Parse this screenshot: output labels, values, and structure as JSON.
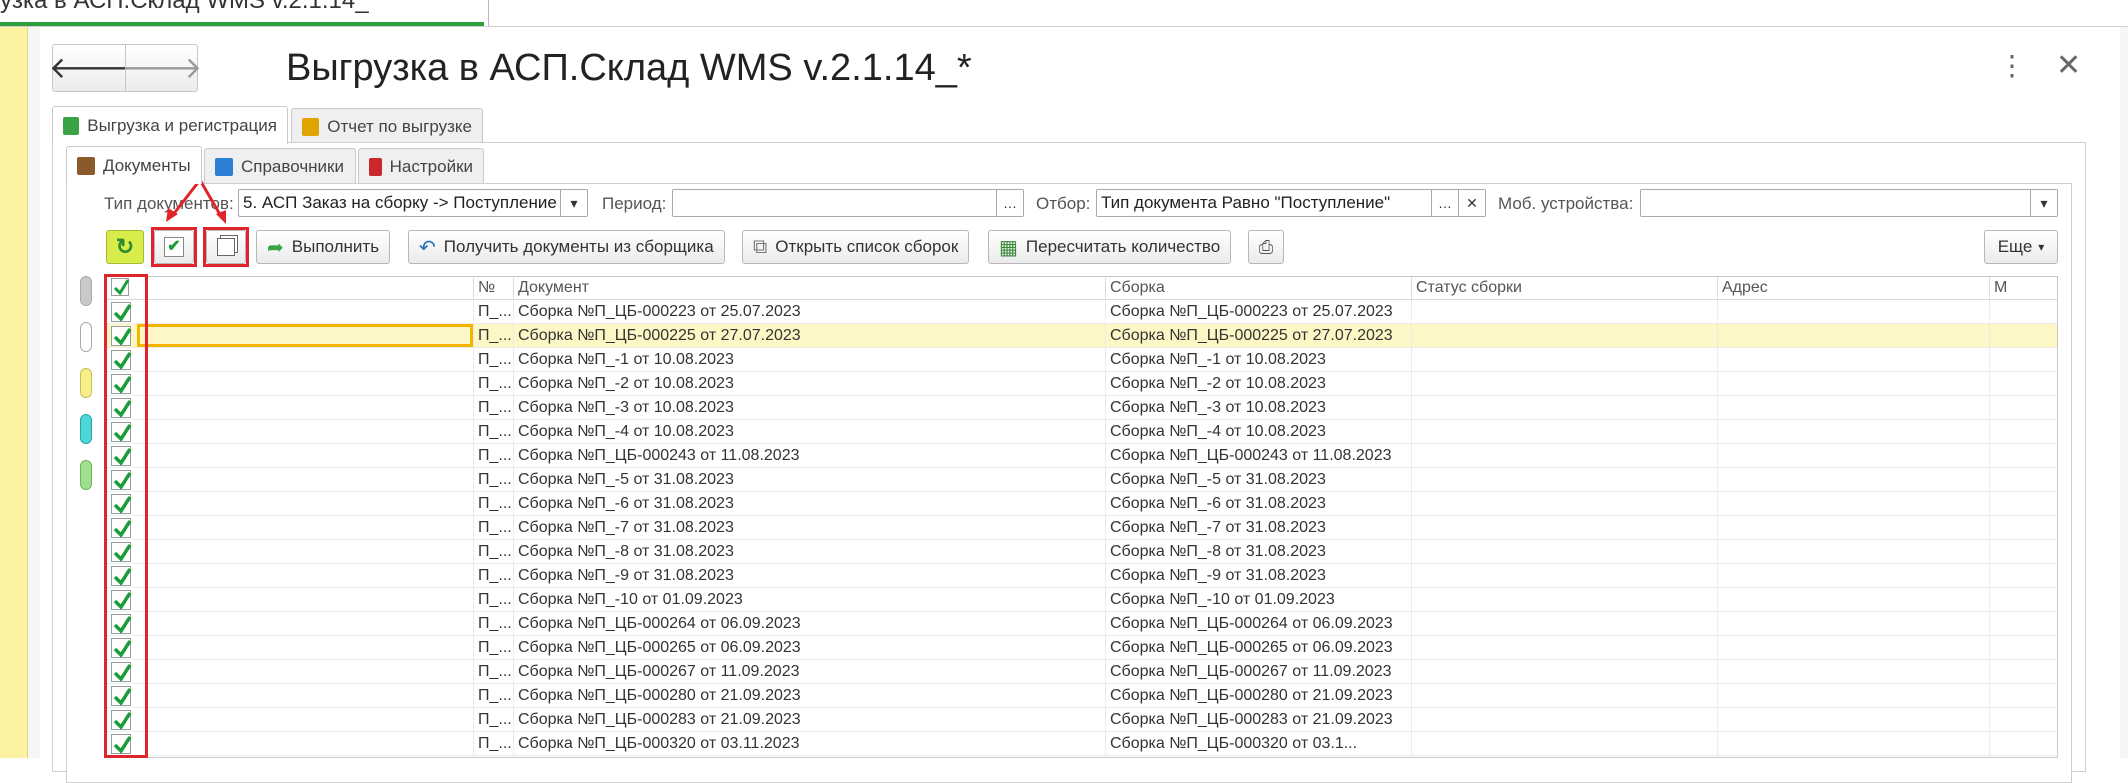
{
  "window_tab": {
    "title": "узка в АСП.Склад WMS v.2.1.14_"
  },
  "header": {
    "title": "Выгрузка в АСП.Склад WMS v.2.1.14_*",
    "back": "🡐",
    "forward": "🡒",
    "menu": "⋮",
    "close": "✕"
  },
  "tabs": [
    {
      "label": "Выгрузка и регистрация",
      "icon": "upload-register-icon",
      "color": "#3aa346"
    },
    {
      "label": "Отчет по выгрузке",
      "icon": "report-icon",
      "color": "#e0a300"
    }
  ],
  "subtabs": [
    {
      "label": "Документы",
      "icon": "briefcase-icon",
      "color": "#8a5a2b"
    },
    {
      "label": "Справочники",
      "icon": "catalog-icon",
      "color": "#2d7fd3"
    },
    {
      "label": "Настройки",
      "icon": "settings-icon",
      "color": "#c9282d"
    }
  ],
  "filters": {
    "doc_type_label": "Тип документов:",
    "doc_type_value": "5. АСП Заказ на сборку -> Поступление",
    "period_label": "Период:",
    "period_value": "",
    "filter_label": "Отбор:",
    "filter_value": "Тип документа Равно \"Поступление\"",
    "mobile_label": "Моб. устройства:",
    "mobile_value": ""
  },
  "toolbar": {
    "execute": "Выполнить",
    "get_docs": "Получить документы из сборщика",
    "open_list": "Открыть список сборок",
    "recount": "Пересчитать количество",
    "more": "Еще"
  },
  "table": {
    "columns": [
      "№",
      "Документ",
      "Сборка",
      "Статус сборки",
      "Адрес",
      "М"
    ],
    "rows": [
      {
        "num": "П_...",
        "doc": "Сборка №П_ЦБ-000223 от 25.07.2023",
        "assembly": "Сборка №П_ЦБ-000223 от 25.07.2023"
      },
      {
        "num": "П_...",
        "doc": "Сборка №П_ЦБ-000225 от 27.07.2023",
        "assembly": "Сборка №П_ЦБ-000225 от 27.07.2023"
      },
      {
        "num": "П_...",
        "doc": "Сборка №П_-1 от 10.08.2023",
        "assembly": "Сборка №П_-1 от 10.08.2023"
      },
      {
        "num": "П_...",
        "doc": "Сборка №П_-2 от 10.08.2023",
        "assembly": "Сборка №П_-2 от 10.08.2023"
      },
      {
        "num": "П_...",
        "doc": "Сборка №П_-3 от 10.08.2023",
        "assembly": "Сборка №П_-3 от 10.08.2023"
      },
      {
        "num": "П_...",
        "doc": "Сборка №П_-4 от 10.08.2023",
        "assembly": "Сборка №П_-4 от 10.08.2023"
      },
      {
        "num": "П_...",
        "doc": "Сборка №П_ЦБ-000243 от 11.08.2023",
        "assembly": "Сборка №П_ЦБ-000243 от 11.08.2023"
      },
      {
        "num": "П_...",
        "doc": "Сборка №П_-5 от 31.08.2023",
        "assembly": "Сборка №П_-5 от 31.08.2023"
      },
      {
        "num": "П_...",
        "doc": "Сборка №П_-6 от 31.08.2023",
        "assembly": "Сборка №П_-6 от 31.08.2023"
      },
      {
        "num": "П_...",
        "doc": "Сборка №П_-7 от 31.08.2023",
        "assembly": "Сборка №П_-7 от 31.08.2023"
      },
      {
        "num": "П_...",
        "doc": "Сборка №П_-8 от 31.08.2023",
        "assembly": "Сборка №П_-8 от 31.08.2023"
      },
      {
        "num": "П_...",
        "doc": "Сборка №П_-9 от 31.08.2023",
        "assembly": "Сборка №П_-9 от 31.08.2023"
      },
      {
        "num": "П_...",
        "doc": "Сборка №П_-10 от 01.09.2023",
        "assembly": "Сборка №П_-10 от 01.09.2023"
      },
      {
        "num": "П_...",
        "doc": "Сборка №П_ЦБ-000264 от 06.09.2023",
        "assembly": "Сборка №П_ЦБ-000264 от 06.09.2023"
      },
      {
        "num": "П_...",
        "doc": "Сборка №П_ЦБ-000265 от 06.09.2023",
        "assembly": "Сборка №П_ЦБ-000265 от 06.09.2023"
      },
      {
        "num": "П_...",
        "doc": "Сборка №П_ЦБ-000267 от 11.09.2023",
        "assembly": "Сборка №П_ЦБ-000267 от 11.09.2023"
      },
      {
        "num": "П_...",
        "doc": "Сборка №П_ЦБ-000280 от 21.09.2023",
        "assembly": "Сборка №П_ЦБ-000280 от 21.09.2023"
      },
      {
        "num": "П_...",
        "doc": "Сборка №П_ЦБ-000283 от 21.09.2023",
        "assembly": "Сборка №П_ЦБ-000283 от 21.09.2023"
      },
      {
        "num": "П_...",
        "doc": "Сборка №П_ЦБ-000320       от 03.11.2023",
        "assembly": "Сборка №П_ЦБ-000320       от 03.1..."
      }
    ]
  },
  "colors": {
    "check_green": "#1a9c3a",
    "highlight_red": "#e0242b",
    "selected_row": "#fdf7c6",
    "focus_border": "#f4b400"
  }
}
